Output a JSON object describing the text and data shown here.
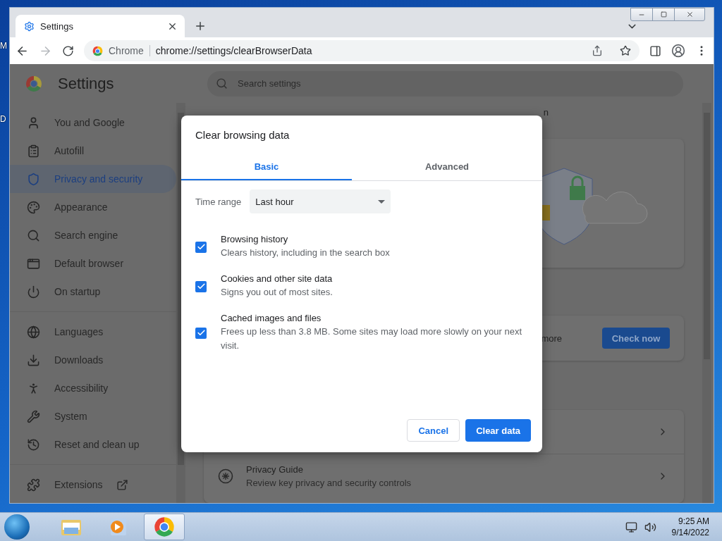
{
  "desktop": {
    "icon_labels": [
      "M",
      "D"
    ]
  },
  "browser": {
    "tabs": [
      {
        "title": "Settings",
        "selected": true
      }
    ],
    "address": {
      "site_label": "Chrome",
      "url": "chrome://settings/clearBrowserData"
    }
  },
  "settings": {
    "title": "Settings",
    "search": {
      "placeholder": "Search settings"
    },
    "sidebar": {
      "groups": [
        [
          {
            "label": "You and Google",
            "selected": false
          },
          {
            "label": "Autofill",
            "selected": false
          },
          {
            "label": "Privacy and security",
            "selected": true
          },
          {
            "label": "Appearance",
            "selected": false
          },
          {
            "label": "Search engine",
            "selected": false
          },
          {
            "label": "Default browser",
            "selected": false
          },
          {
            "label": "On startup",
            "selected": false
          }
        ],
        [
          {
            "label": "Languages",
            "selected": false
          },
          {
            "label": "Downloads",
            "selected": false
          },
          {
            "label": "Accessibility",
            "selected": false
          },
          {
            "label": "System",
            "selected": false
          },
          {
            "label": "Reset and clean up",
            "selected": false
          }
        ],
        [
          {
            "label": "Extensions",
            "selected": false,
            "external": true
          }
        ]
      ]
    },
    "main": {
      "heading_fragment": "n",
      "check_card": {
        "text": "more",
        "button": "Check now"
      },
      "rows": [
        {
          "title": "Privacy Guide",
          "subtitle": "Review key privacy and security controls"
        }
      ]
    }
  },
  "dialog": {
    "title": "Clear browsing data",
    "tabs": [
      {
        "label": "Basic",
        "selected": true
      },
      {
        "label": "Advanced",
        "selected": false
      }
    ],
    "time_range": {
      "label": "Time range",
      "value": "Last hour"
    },
    "options": [
      {
        "title": "Browsing history",
        "description": "Clears history, including in the search box",
        "checked": true
      },
      {
        "title": "Cookies and other site data",
        "description": "Signs you out of most sites.",
        "checked": true
      },
      {
        "title": "Cached images and files",
        "description": "Frees up less than 3.8 MB. Some sites may load more slowly on your next visit.",
        "checked": true
      }
    ],
    "buttons": [
      {
        "label": "Cancel",
        "kind": "secondary"
      },
      {
        "label": "Clear data",
        "kind": "primary"
      }
    ]
  },
  "taskbar": {
    "items": [
      {
        "kind": "folder",
        "active": false
      },
      {
        "kind": "media",
        "active": false
      },
      {
        "kind": "browser",
        "active": true
      }
    ],
    "clock": {
      "time": "9:25 AM",
      "date": "9/14/2022"
    }
  }
}
